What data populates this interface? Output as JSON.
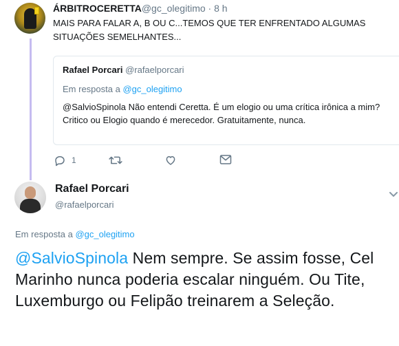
{
  "parent_tweet": {
    "author_name": "ÁRBITROCERETTA",
    "handle": "@gc_olegitimo",
    "separator": " · ",
    "time": "8 h",
    "text": "MAIS PARA FALAR A, B OU C...TEMOS QUE TER ENFRENTADO ALGUMAS SITUAÇÕES SEMELHANTES...",
    "avatar_icon": "referee-avatar-icon"
  },
  "quoted_tweet": {
    "author_name": "Rafael Porcari",
    "handle": "@rafaelporcari",
    "reply_prefix": "Em resposta a ",
    "reply_to": "@gc_olegitimo",
    "text": "@SalvioSpinola Não entendi Ceretta. É um elogio ou uma crítica irônica a mim?\nCritico ou Elogio quando é merecedor. Gratuitamente, nunca."
  },
  "actions": {
    "reply_count": "1",
    "icons": [
      "reply-icon",
      "retweet-icon",
      "like-icon",
      "message-icon"
    ]
  },
  "main_tweet": {
    "author_name": "Rafael Porcari",
    "handle": "@rafaelporcari",
    "reply_prefix": "Em resposta a ",
    "reply_to": "@gc_olegitimo",
    "mention": "@SalvioSpinola",
    "text": " Nem sempre. Se assim fosse, Cel Marinho nunca poderia escalar ninguém. Ou Tite, Luxemburgo ou Felipão treinarem a Seleção.",
    "avatar_icon": "user-avatar-icon"
  },
  "colors": {
    "link": "#1da1f2",
    "muted": "#657786",
    "thread_line": "#c5bbf0",
    "border": "#e1e8ed"
  }
}
